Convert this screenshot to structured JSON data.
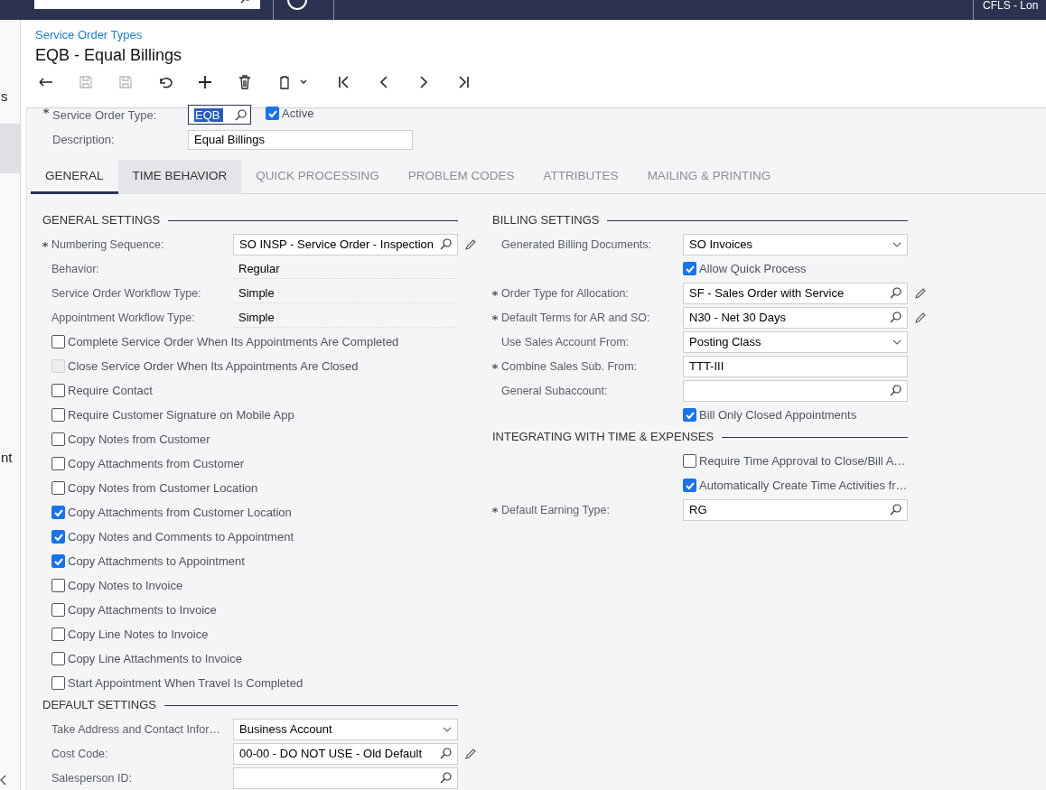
{
  "top_bar": {
    "company": "CFLS - Lon"
  },
  "sidebar": {
    "items": [
      {
        "label": "s",
        "selected": false
      },
      {
        "label": "nt",
        "selected": false
      }
    ]
  },
  "breadcrumb": "Service Order Types",
  "title": "EQB - Equal Billings",
  "toolbar": [
    {
      "kind": "back",
      "disabled": false
    },
    {
      "kind": "save-close",
      "disabled": true
    },
    {
      "kind": "save",
      "disabled": true
    },
    {
      "kind": "undo",
      "disabled": false
    },
    {
      "kind": "add",
      "disabled": false
    },
    {
      "kind": "delete",
      "disabled": false
    },
    {
      "kind": "paste",
      "disabled": false
    },
    {
      "kind": "first",
      "disabled": false
    },
    {
      "kind": "previous",
      "disabled": false
    },
    {
      "kind": "next",
      "disabled": false
    },
    {
      "kind": "last",
      "disabled": false
    }
  ],
  "header": {
    "type_label": "Service Order Type:",
    "type_required": true,
    "type_value": "EQB",
    "active": {
      "label": "Active",
      "checked": true
    },
    "description_label": "Description:",
    "description_value": "Equal Billings"
  },
  "tabs": [
    {
      "label": "GENERAL",
      "selected": true,
      "hovered": false
    },
    {
      "label": "TIME BEHAVIOR",
      "selected": false,
      "hovered": true
    },
    {
      "label": "QUICK PROCESSING",
      "selected": false,
      "hovered": false
    },
    {
      "label": "PROBLEM CODES",
      "selected": false,
      "hovered": false
    },
    {
      "label": "ATTRIBUTES",
      "selected": false,
      "hovered": false
    },
    {
      "label": "MAILING & PRINTING",
      "selected": false,
      "hovered": false
    }
  ],
  "left_sections": [
    {
      "title": "GENERAL SETTINGS",
      "rows": [
        {
          "kind": "lookup",
          "label": "Numbering Sequence:",
          "required": true,
          "value": "SO INSP - Service Order - Inspection",
          "edit": true
        },
        {
          "kind": "readonly",
          "label": "Behavior:",
          "required": false,
          "value": "Regular"
        },
        {
          "kind": "readonly",
          "label": "Service Order Workflow Type:",
          "required": false,
          "value": "Simple"
        },
        {
          "kind": "readonly",
          "label": "Appointment Workflow Type:",
          "required": false,
          "value": "Simple"
        },
        {
          "kind": "checkbox",
          "label": "Complete Service Order When Its Appointments Are Completed",
          "checked": false,
          "disabled": false
        },
        {
          "kind": "checkbox",
          "label": "Close Service Order When Its Appointments Are Closed",
          "checked": false,
          "disabled": true
        },
        {
          "kind": "checkbox",
          "label": "Require Contact",
          "checked": false,
          "disabled": false
        },
        {
          "kind": "checkbox",
          "label": "Require Customer Signature on Mobile App",
          "checked": false,
          "disabled": false
        },
        {
          "kind": "checkbox",
          "label": "Copy Notes from Customer",
          "checked": false,
          "disabled": false
        },
        {
          "kind": "checkbox",
          "label": "Copy Attachments from Customer",
          "checked": false,
          "disabled": false
        },
        {
          "kind": "checkbox",
          "label": "Copy Notes from Customer Location",
          "checked": false,
          "disabled": false
        },
        {
          "kind": "checkbox",
          "label": "Copy Attachments from Customer Location",
          "checked": true,
          "disabled": false
        },
        {
          "kind": "checkbox",
          "label": "Copy Notes and Comments to Appointment",
          "checked": true,
          "disabled": false
        },
        {
          "kind": "checkbox",
          "label": "Copy Attachments to Appointment",
          "checked": true,
          "disabled": false
        },
        {
          "kind": "checkbox",
          "label": "Copy Notes to Invoice",
          "checked": false,
          "disabled": false
        },
        {
          "kind": "checkbox",
          "label": "Copy Attachments to Invoice",
          "checked": false,
          "disabled": false
        },
        {
          "kind": "checkbox",
          "label": "Copy Line Notes to Invoice",
          "checked": false,
          "disabled": false
        },
        {
          "kind": "checkbox",
          "label": "Copy Line Attachments to Invoice",
          "checked": false,
          "disabled": false
        },
        {
          "kind": "checkbox",
          "label": "Start Appointment When Travel Is Completed",
          "checked": false,
          "disabled": false
        }
      ]
    },
    {
      "title": "DEFAULT SETTINGS",
      "rows": [
        {
          "kind": "select",
          "label": "Take Address and Contact Infor…",
          "required": false,
          "value": "Business Account"
        },
        {
          "kind": "lookup",
          "label": "Cost Code:",
          "required": false,
          "value": "00-00 - DO NOT USE - Old Default",
          "edit": true
        },
        {
          "kind": "lookup",
          "label": "Salesperson ID:",
          "required": false,
          "edit": false
        }
      ]
    }
  ],
  "right_sections": [
    {
      "title": "BILLING SETTINGS",
      "rows": [
        {
          "kind": "select",
          "label": "Generated Billing Documents:",
          "required": false,
          "value": "SO Invoices"
        },
        {
          "kind": "checkbox",
          "label": "Allow Quick Process",
          "checked": true,
          "disabled": false
        },
        {
          "kind": "lookup",
          "label": "Order Type for Allocation:",
          "required": true,
          "value": "SF - Sales Order with Service",
          "edit": true
        },
        {
          "kind": "lookup",
          "label": "Default Terms for AR and SO:",
          "required": true,
          "value": "N30 - Net 30 Days",
          "edit": true
        },
        {
          "kind": "select",
          "label": "Use Sales Account From:",
          "required": false,
          "value": "Posting Class"
        },
        {
          "kind": "text",
          "label": "Combine Sales Sub. From:",
          "required": true,
          "value": "TTT-III"
        },
        {
          "kind": "lookup",
          "label": "General Subaccount:",
          "required": false,
          "edit": false
        },
        {
          "kind": "checkbox",
          "label": "Bill Only Closed Appointments",
          "checked": true,
          "disabled": false
        }
      ]
    },
    {
      "title": "INTEGRATING WITH TIME & EXPENSES",
      "rows": [
        {
          "kind": "checkbox",
          "label": "Require Time Approval to Close/Bill A…",
          "checked": false,
          "disabled": false
        },
        {
          "kind": "checkbox",
          "label": "Automatically Create Time Activities fr…",
          "checked": true,
          "disabled": false
        },
        {
          "kind": "lookup",
          "label": "Default Earning Type:",
          "required": true,
          "value": "RG",
          "edit": false
        }
      ]
    }
  ]
}
